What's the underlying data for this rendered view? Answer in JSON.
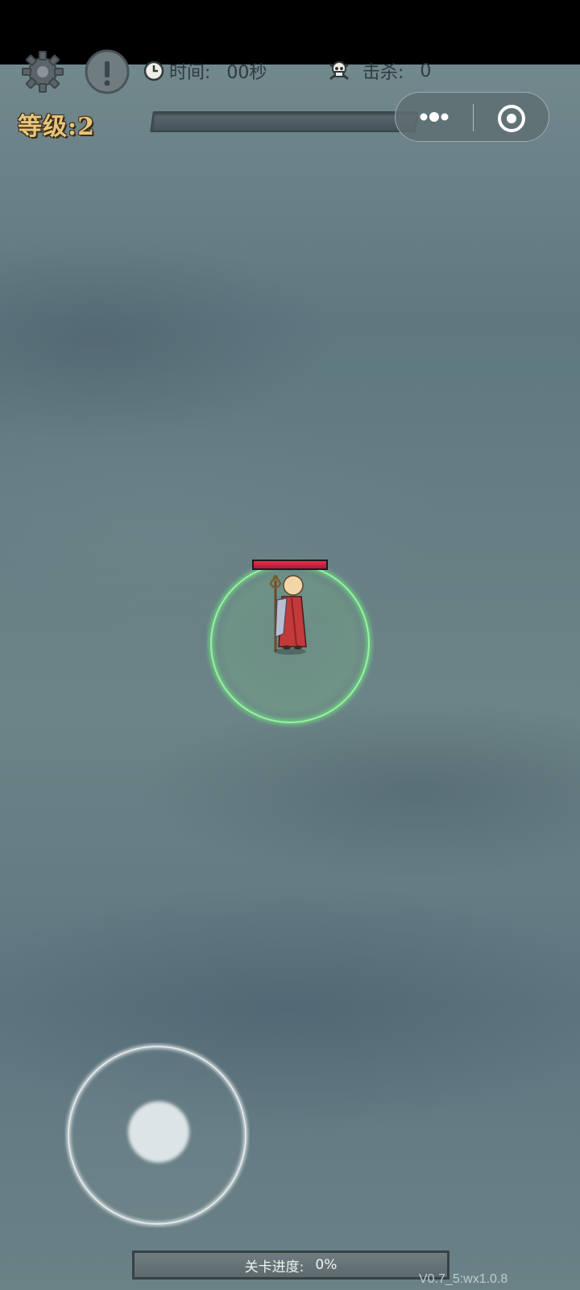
{
  "hud": {
    "time_label": "时间:",
    "time_value": "00秒",
    "kills_label": "击杀:",
    "kills_value": "0",
    "level_label": "等级:",
    "level_value": "2",
    "xp_progress": 0
  },
  "miniprogram_capsule": {
    "more_icon": "more-dots-icon",
    "close_icon": "target-circle-icon"
  },
  "player": {
    "health_fraction": 1.0,
    "aura_color": "#6fdc82"
  },
  "footer": {
    "stage_progress_label": "关卡进度:",
    "stage_progress_value": "0%",
    "version": "V0.7_5:wx1.0.8"
  },
  "colors": {
    "level_text": "#e7c57c",
    "hp_bar": "#d0213f",
    "background": "#6c8286"
  }
}
